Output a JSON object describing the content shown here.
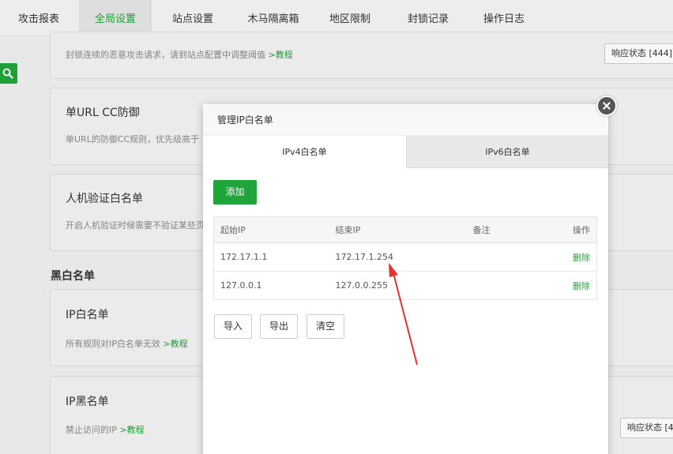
{
  "top_tabs": [
    {
      "label": "攻击报表",
      "active": false
    },
    {
      "label": "全局设置",
      "active": true
    },
    {
      "label": "站点设置",
      "active": false
    },
    {
      "label": "木马隔离箱",
      "active": false
    },
    {
      "label": "地区限制",
      "active": false
    },
    {
      "label": "封锁记录",
      "active": false
    },
    {
      "label": "操作日志",
      "active": false
    }
  ],
  "page": {
    "card0": {
      "desc": "封锁连续的恶意攻击请求，请到站点配置中调整阈值",
      "link": ">教程",
      "button": "响应状态 [444]"
    },
    "card1": {
      "title": "单URL CC防御",
      "desc": "单URL的防御CC规则，优先级高于"
    },
    "card2": {
      "title": "人机验证白名单",
      "desc": "开启人机验证时候需要不验证某些页"
    },
    "section_title": "黑白名单",
    "card3": {
      "title": "IP白名单",
      "desc": "所有规则对IP白名单无效",
      "link": ">教程"
    },
    "card4": {
      "title": "IP黑名单",
      "desc": "禁止访问的IP",
      "link": ">教程",
      "button": "响应状态 [4"
    }
  },
  "modal": {
    "title": "管理IP白名单",
    "tabs": [
      {
        "label": "IPv4白名单",
        "active": true
      },
      {
        "label": "IPv6白名单",
        "active": false
      }
    ],
    "add_label": "添加",
    "columns": {
      "start_ip": "起始IP",
      "end_ip": "结束IP",
      "remark": "备注",
      "action": "操作"
    },
    "rows": [
      {
        "start_ip": "172.17.1.1",
        "end_ip": "172.17.1.254",
        "remark": "",
        "action": "删除"
      },
      {
        "start_ip": "127.0.0.1",
        "end_ip": "127.0.0.255",
        "remark": "",
        "action": "删除"
      }
    ],
    "footer_buttons": {
      "import": "导入",
      "export": "导出",
      "clear": "清空"
    }
  },
  "colors": {
    "accent": "#20a53a",
    "annotation_arrow": "#e8302f"
  }
}
